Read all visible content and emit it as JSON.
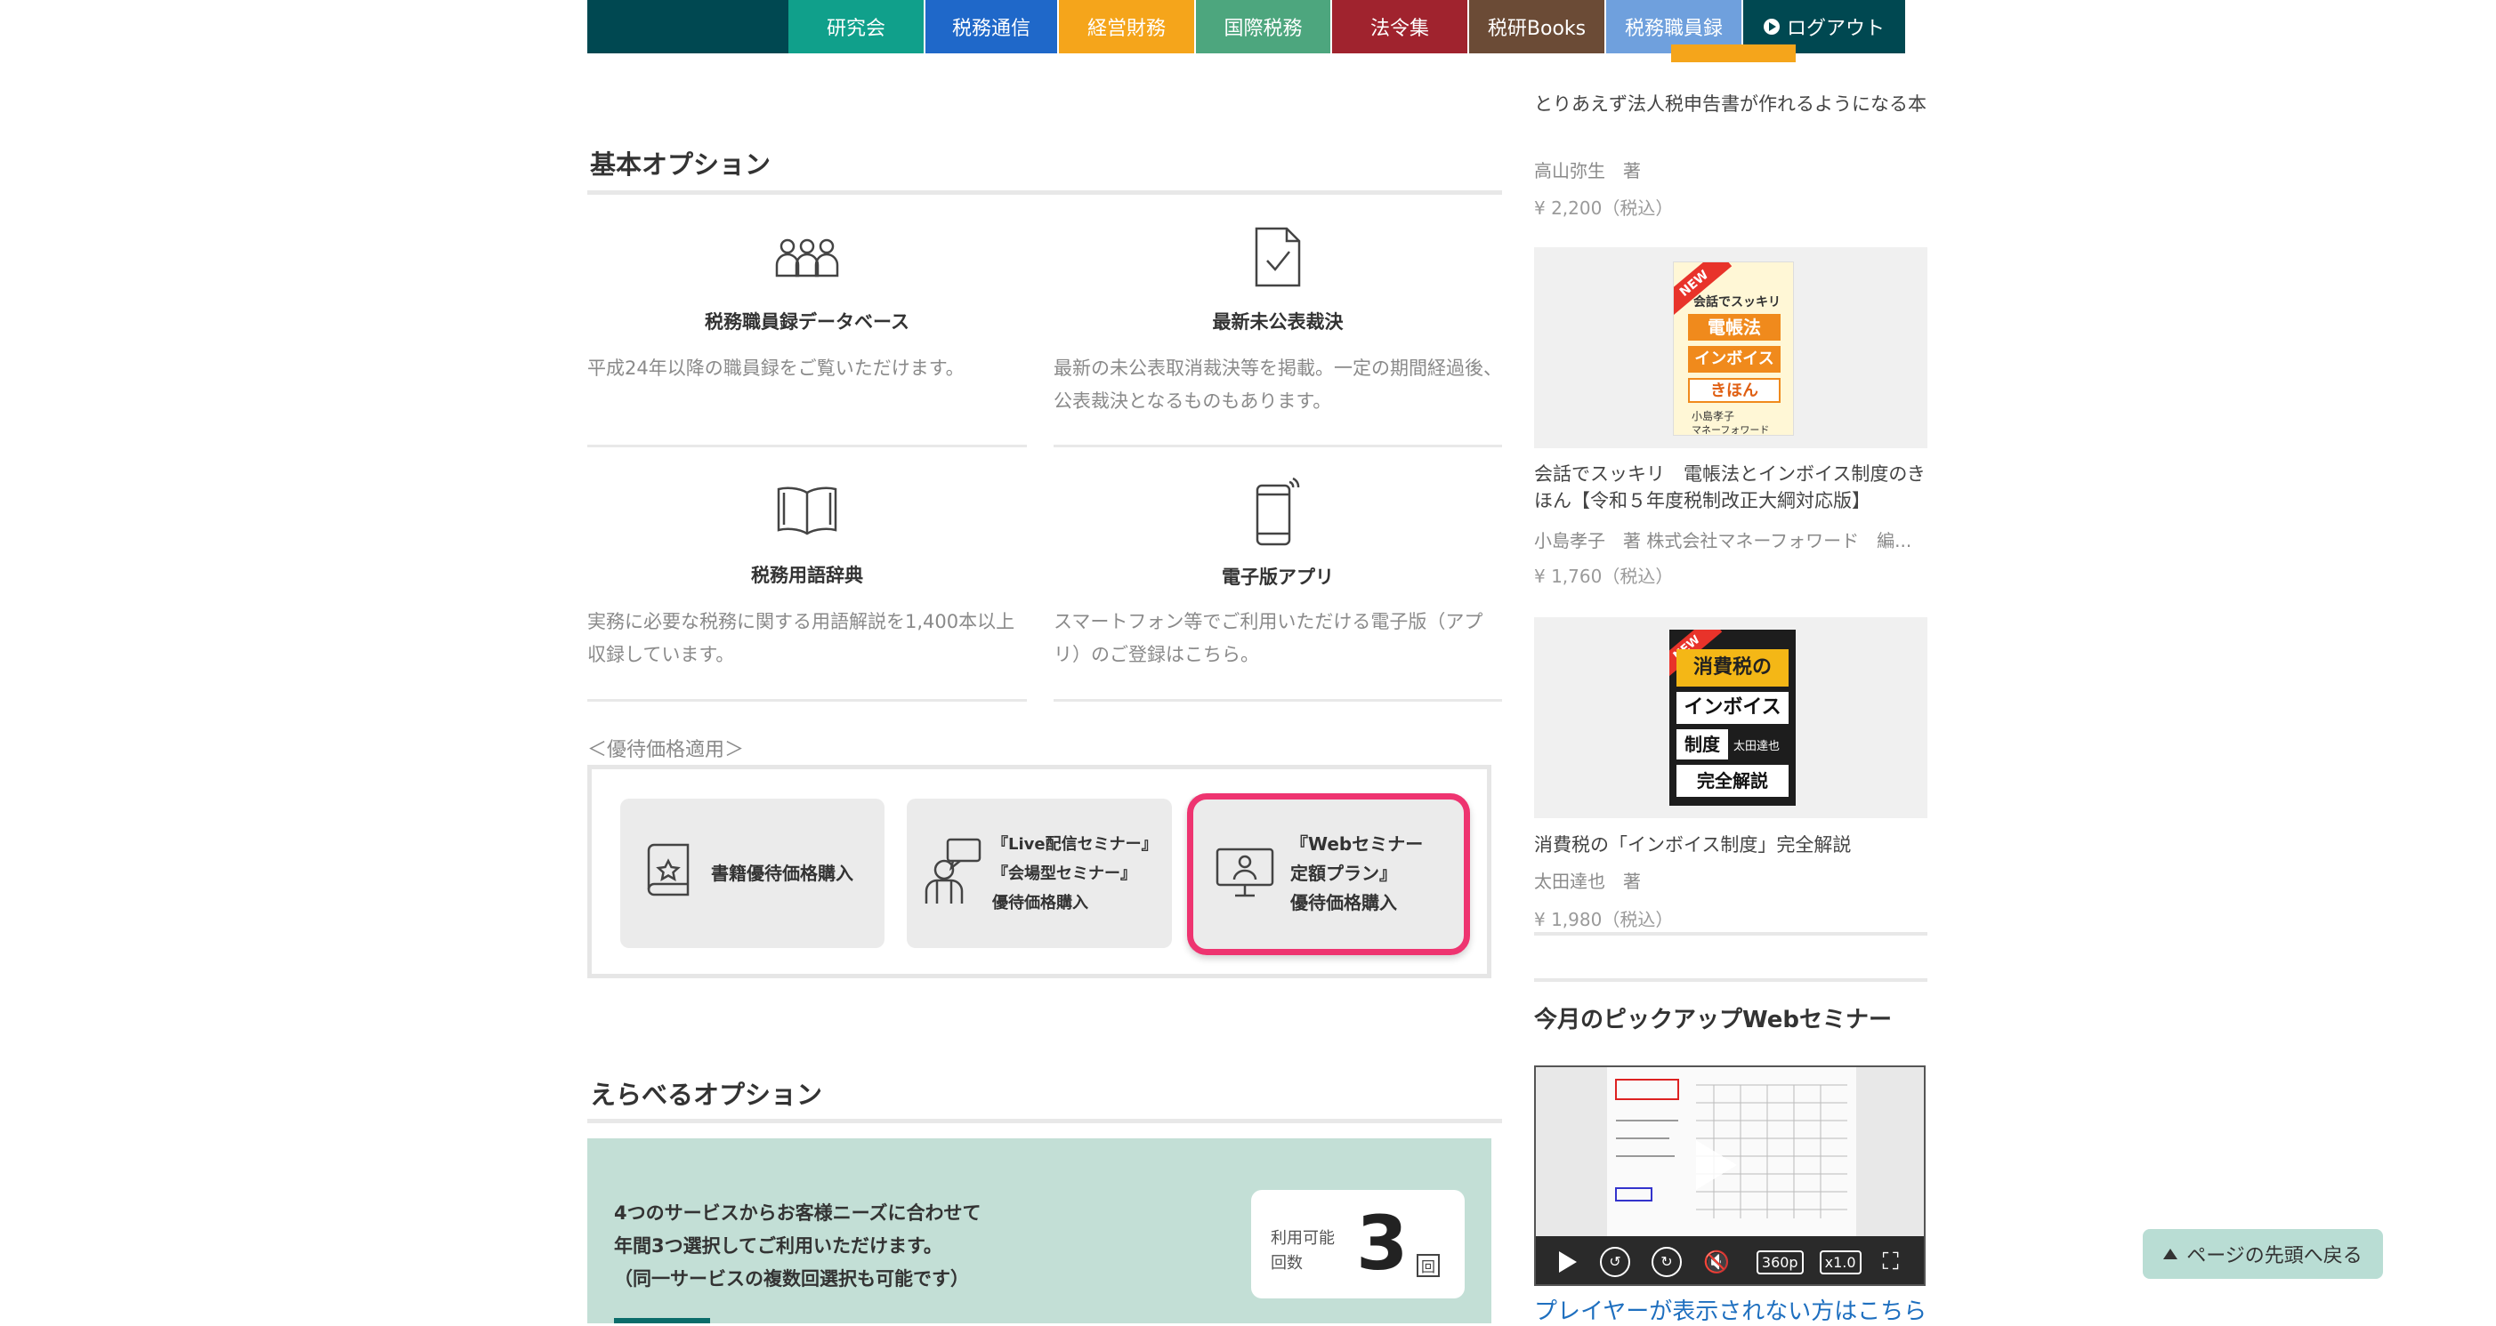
{
  "nav": {
    "items": [
      {
        "label": "研究会",
        "color": "#10a08b"
      },
      {
        "label": "税務通信",
        "color": "#1f68c9"
      },
      {
        "label": "経営財務",
        "color": "#f5a51b"
      },
      {
        "label": "国際税務",
        "color": "#4da67e"
      },
      {
        "label": "法令集",
        "color": "#a0232e"
      },
      {
        "label": "税研Books",
        "color": "#6b4b36"
      },
      {
        "label": "税務職員録",
        "color": "#6fa0dd"
      },
      {
        "label": "ログアウト",
        "color": "#004851"
      }
    ]
  },
  "basic": {
    "title": "基本オプション",
    "options": [
      {
        "icon": "people-icon",
        "title": "税務職員録データベース",
        "desc": "平成24年以降の職員録をご覧いただけます。"
      },
      {
        "icon": "document-check-icon",
        "title": "最新未公表裁決",
        "desc": "最新の未公表取消裁決等を掲載。一定の期間経過後、公表裁決となるものもあります。"
      },
      {
        "icon": "book-open-icon",
        "title": "税務用語辞典",
        "desc": "実務に必要な税務に関する用語解説を1,400本以上収録しています。"
      },
      {
        "icon": "smartphone-icon",
        "title": "電子版アプリ",
        "desc": "スマートフォン等でご利用いただける電子版（アプリ）のご登録はこちら。"
      }
    ]
  },
  "benefit": {
    "note": "＜優待価格適用＞",
    "buttons": [
      {
        "icon": "book-star-icon",
        "lines": [
          "書籍優待価格購入"
        ]
      },
      {
        "icon": "presenter-icon",
        "lines": [
          "『Live配信セミナー』",
          "『会場型セミナー』",
          "優待価格購入"
        ]
      },
      {
        "icon": "monitor-user-icon",
        "lines": [
          "『Webセミナー",
          "定額プラン』",
          "優待価格購入"
        ]
      }
    ]
  },
  "select": {
    "title": "えらべるオプション",
    "lines": [
      "4つのサービスからお客様ニーズに合わせて",
      "年間3つ選択してご利用いただけます。",
      "（同一サービスの複数回選択も可能です）"
    ],
    "count_label_1": "利用可能",
    "count_label_2": "回数",
    "count": "3",
    "unit": "回"
  },
  "sidebar": {
    "books": [
      {
        "title": "とりあえず法人税申告書が作れるようになる本",
        "author": "高山弥生　著",
        "price": "¥ 2,200（税込）"
      },
      {
        "cover": {
          "badge": "NEW",
          "top": "会話でスッキリ",
          "l1": "電帳法",
          "l2": "インボイス",
          "l3": "きほん",
          "author": "小島孝子",
          "pub": "マネーフォワード"
        },
        "title": "会話でスッキリ　電帳法とインボイス制度のきほん【令和５年度税制改正大綱対応版】",
        "author": "小島孝子　著 株式会社マネーフォワード　編...",
        "price": "¥ 1,760（税込）"
      },
      {
        "cover": {
          "badge": "NEW",
          "l1": "消費税の",
          "l2": "インボイス",
          "l3": "制度",
          "author": "太田達也",
          "l4": "完全解説"
        },
        "title": "消費税の「インボイス制度」完全解説",
        "author": "太田達也　著",
        "price": "¥ 1,980（税込）"
      }
    ],
    "webinar_title": "今月のピックアップWebセミナー",
    "player": {
      "quality": "360p",
      "speed": "x1.0"
    },
    "player_link": "プレイヤーが表示されない方はこちら"
  },
  "back_to_top": "ページの先頭へ戻る"
}
